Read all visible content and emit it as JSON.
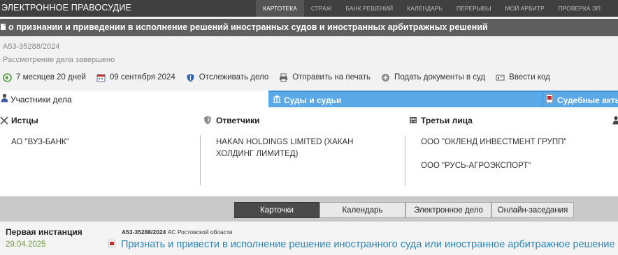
{
  "brand": "ЭЛЕКТРОННОЕ ПРАВОСУДИЕ",
  "nav": [
    "КАРТОТЕКА",
    "СТРАЖ",
    "БАНК РЕШЕНИЙ",
    "КАЛЕНДАРЬ",
    "ПЕРЕРЫВЫ",
    "МОЙ АРБИТР",
    "ПРОВЕРКА ЭП"
  ],
  "case": {
    "title": "о признании и приведении в исполнение решений иностранных судов и иностранных арбитражных решений",
    "number": "А53-35288/2024",
    "status": "Рассмотрение дела завершено"
  },
  "actions": {
    "duration": "7 месяцев 20 дней",
    "date": "09 сентября 2024",
    "track": "Отслеживать дело",
    "print": "Отправить на печать",
    "submit": "Подать документы в суд",
    "code": "Ввести код"
  },
  "tabs": {
    "participants": "Участники дела",
    "courts": "Суды и судьи",
    "acts": "Судебные акты"
  },
  "participants": {
    "plaintiffs_label": "Истцы",
    "plaintiffs": [
      "АО \"ВУЗ-БАНК\""
    ],
    "defendants_label": "Ответчики",
    "defendants": [
      "HAKAN HOLDINGS LIMITED (ХАКАН ХОЛДИНГ ЛИМИТЕД)"
    ],
    "third_label": "Третьи лица",
    "third": [
      "ООО \"ОКЛЕНД ИНВЕСТМЕНТ ГРУПП\"",
      "ООО \"РУСЬ-АГРОЭКСПОРТ\""
    ]
  },
  "subtabs": [
    "Карточки",
    "Календарь",
    "Электронное дело",
    "Онлайн-заседания"
  ],
  "instance": {
    "label": "Первая инстанция",
    "date": "29.04.2025",
    "case_number": "А53-35288/2024",
    "court": "АС Ростовской области",
    "link": "Признать и привести в исполнение решение иностранного суда или иностранное арбитражное решение"
  },
  "colors": {
    "nav_bg": "#404040",
    "case_bar": "#5f5f5f",
    "tab_blue": "#5aa9e6",
    "link": "#2a86b8",
    "date_green": "#6b9a3a"
  }
}
